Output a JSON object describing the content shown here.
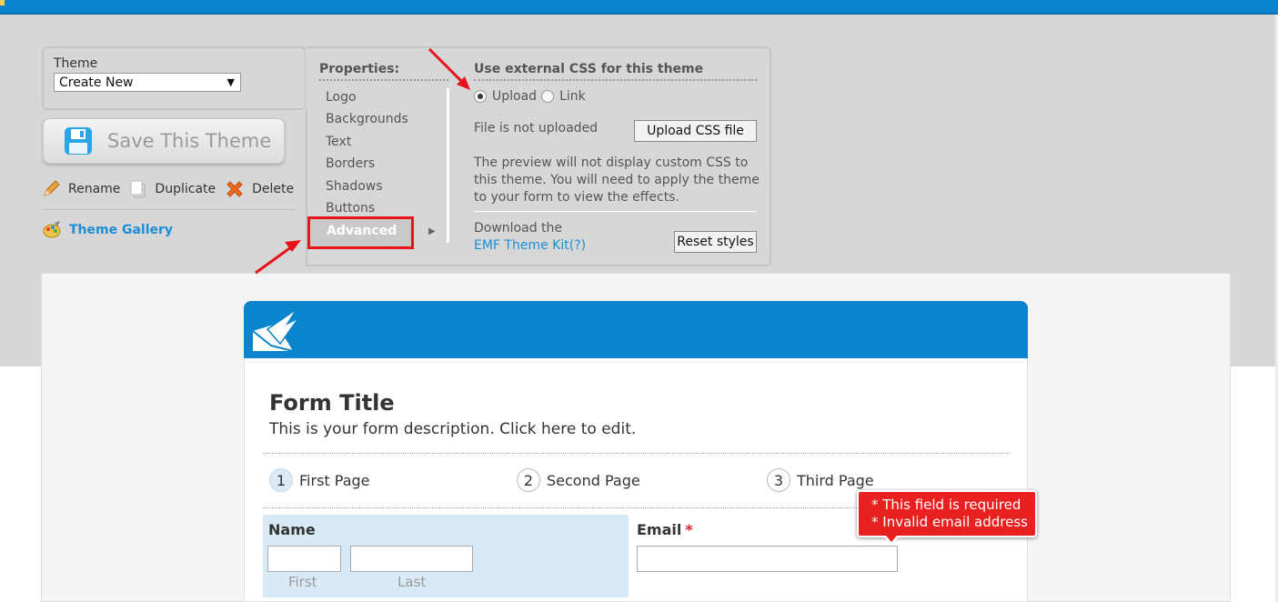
{
  "theme": {
    "label": "Theme",
    "selected": "Create New",
    "save_button": "Save This Theme",
    "actions": {
      "rename": "Rename",
      "duplicate": "Duplicate",
      "delete": "Delete"
    },
    "gallery": "Theme Gallery"
  },
  "properties": {
    "title": "Properties:",
    "items": [
      "Logo",
      "Backgrounds",
      "Text",
      "Borders",
      "Shadows",
      "Buttons",
      "Advanced"
    ],
    "active": "Advanced"
  },
  "external_css": {
    "title": "Use external CSS for this theme",
    "options": [
      "Upload",
      "Link"
    ],
    "selected": "Upload",
    "file_status": "File is not uploaded",
    "upload_button": "Upload CSS file",
    "note": "The preview will not display custom CSS to this theme. You will need to apply the theme to your form to view the effects.",
    "download_text": "Download the",
    "kit_link": "EMF Theme Kit(?)",
    "reset_button": "Reset styles"
  },
  "form": {
    "title": "Form Title",
    "description": "This is your form description. Click here to edit.",
    "steps": [
      {
        "num": "1",
        "label": "First Page"
      },
      {
        "num": "2",
        "label": "Second Page"
      },
      {
        "num": "3",
        "label": "Third Page"
      }
    ],
    "name_label": "Name",
    "first_sub": "First",
    "last_sub": "Last",
    "email_label": "Email",
    "required_mark": "*",
    "errors": [
      "* This field is required",
      "* Invalid email address"
    ]
  },
  "colors": {
    "brand_blue": "#0a84cc",
    "highlight_red": "#e8131a",
    "error_red": "#e8201f",
    "link_blue": "#1b8ed6"
  }
}
